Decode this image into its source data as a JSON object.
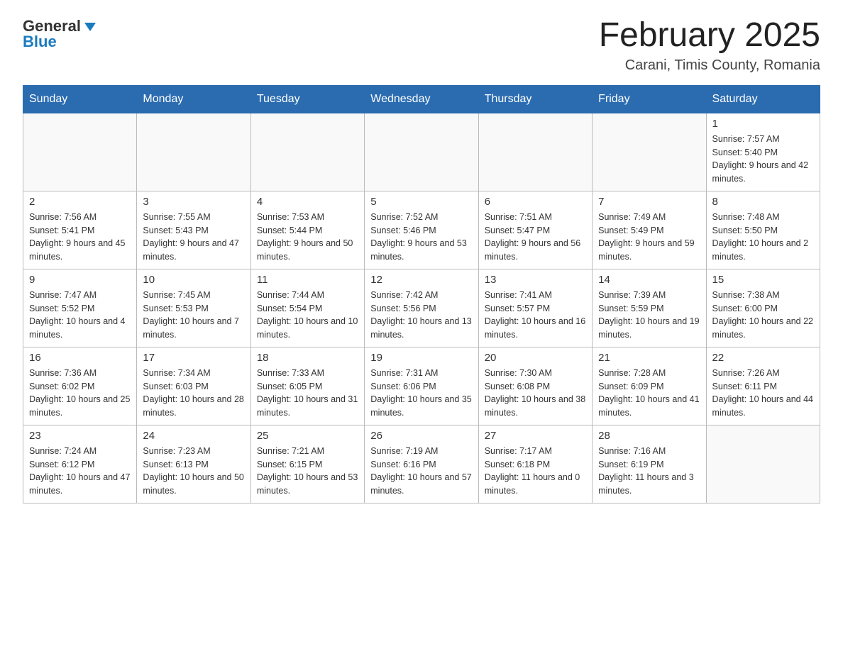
{
  "header": {
    "logo_general": "General",
    "logo_blue": "Blue",
    "month_title": "February 2025",
    "location": "Carani, Timis County, Romania"
  },
  "weekdays": [
    "Sunday",
    "Monday",
    "Tuesday",
    "Wednesday",
    "Thursday",
    "Friday",
    "Saturday"
  ],
  "weeks": [
    [
      {
        "day": "",
        "info": ""
      },
      {
        "day": "",
        "info": ""
      },
      {
        "day": "",
        "info": ""
      },
      {
        "day": "",
        "info": ""
      },
      {
        "day": "",
        "info": ""
      },
      {
        "day": "",
        "info": ""
      },
      {
        "day": "1",
        "info": "Sunrise: 7:57 AM\nSunset: 5:40 PM\nDaylight: 9 hours and 42 minutes."
      }
    ],
    [
      {
        "day": "2",
        "info": "Sunrise: 7:56 AM\nSunset: 5:41 PM\nDaylight: 9 hours and 45 minutes."
      },
      {
        "day": "3",
        "info": "Sunrise: 7:55 AM\nSunset: 5:43 PM\nDaylight: 9 hours and 47 minutes."
      },
      {
        "day": "4",
        "info": "Sunrise: 7:53 AM\nSunset: 5:44 PM\nDaylight: 9 hours and 50 minutes."
      },
      {
        "day": "5",
        "info": "Sunrise: 7:52 AM\nSunset: 5:46 PM\nDaylight: 9 hours and 53 minutes."
      },
      {
        "day": "6",
        "info": "Sunrise: 7:51 AM\nSunset: 5:47 PM\nDaylight: 9 hours and 56 minutes."
      },
      {
        "day": "7",
        "info": "Sunrise: 7:49 AM\nSunset: 5:49 PM\nDaylight: 9 hours and 59 minutes."
      },
      {
        "day": "8",
        "info": "Sunrise: 7:48 AM\nSunset: 5:50 PM\nDaylight: 10 hours and 2 minutes."
      }
    ],
    [
      {
        "day": "9",
        "info": "Sunrise: 7:47 AM\nSunset: 5:52 PM\nDaylight: 10 hours and 4 minutes."
      },
      {
        "day": "10",
        "info": "Sunrise: 7:45 AM\nSunset: 5:53 PM\nDaylight: 10 hours and 7 minutes."
      },
      {
        "day": "11",
        "info": "Sunrise: 7:44 AM\nSunset: 5:54 PM\nDaylight: 10 hours and 10 minutes."
      },
      {
        "day": "12",
        "info": "Sunrise: 7:42 AM\nSunset: 5:56 PM\nDaylight: 10 hours and 13 minutes."
      },
      {
        "day": "13",
        "info": "Sunrise: 7:41 AM\nSunset: 5:57 PM\nDaylight: 10 hours and 16 minutes."
      },
      {
        "day": "14",
        "info": "Sunrise: 7:39 AM\nSunset: 5:59 PM\nDaylight: 10 hours and 19 minutes."
      },
      {
        "day": "15",
        "info": "Sunrise: 7:38 AM\nSunset: 6:00 PM\nDaylight: 10 hours and 22 minutes."
      }
    ],
    [
      {
        "day": "16",
        "info": "Sunrise: 7:36 AM\nSunset: 6:02 PM\nDaylight: 10 hours and 25 minutes."
      },
      {
        "day": "17",
        "info": "Sunrise: 7:34 AM\nSunset: 6:03 PM\nDaylight: 10 hours and 28 minutes."
      },
      {
        "day": "18",
        "info": "Sunrise: 7:33 AM\nSunset: 6:05 PM\nDaylight: 10 hours and 31 minutes."
      },
      {
        "day": "19",
        "info": "Sunrise: 7:31 AM\nSunset: 6:06 PM\nDaylight: 10 hours and 35 minutes."
      },
      {
        "day": "20",
        "info": "Sunrise: 7:30 AM\nSunset: 6:08 PM\nDaylight: 10 hours and 38 minutes."
      },
      {
        "day": "21",
        "info": "Sunrise: 7:28 AM\nSunset: 6:09 PM\nDaylight: 10 hours and 41 minutes."
      },
      {
        "day": "22",
        "info": "Sunrise: 7:26 AM\nSunset: 6:11 PM\nDaylight: 10 hours and 44 minutes."
      }
    ],
    [
      {
        "day": "23",
        "info": "Sunrise: 7:24 AM\nSunset: 6:12 PM\nDaylight: 10 hours and 47 minutes."
      },
      {
        "day": "24",
        "info": "Sunrise: 7:23 AM\nSunset: 6:13 PM\nDaylight: 10 hours and 50 minutes."
      },
      {
        "day": "25",
        "info": "Sunrise: 7:21 AM\nSunset: 6:15 PM\nDaylight: 10 hours and 53 minutes."
      },
      {
        "day": "26",
        "info": "Sunrise: 7:19 AM\nSunset: 6:16 PM\nDaylight: 10 hours and 57 minutes."
      },
      {
        "day": "27",
        "info": "Sunrise: 7:17 AM\nSunset: 6:18 PM\nDaylight: 11 hours and 0 minutes."
      },
      {
        "day": "28",
        "info": "Sunrise: 7:16 AM\nSunset: 6:19 PM\nDaylight: 11 hours and 3 minutes."
      },
      {
        "day": "",
        "info": ""
      }
    ]
  ]
}
